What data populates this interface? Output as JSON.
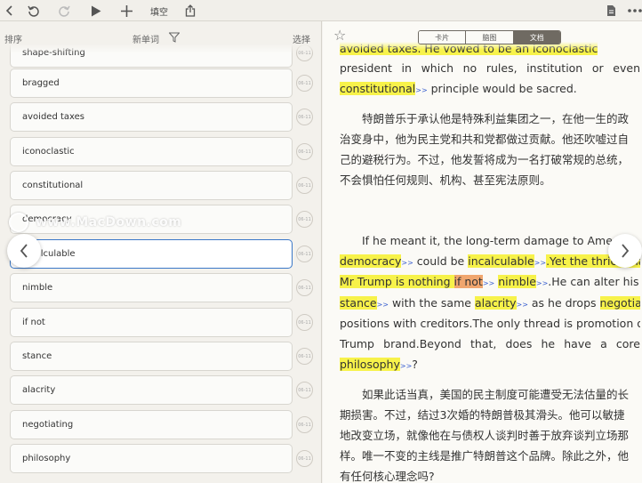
{
  "toolbar": {
    "fill_label": "填空"
  },
  "left_header": {
    "sort_label": "排序",
    "new_words_label": "新单词",
    "select_label": "选择"
  },
  "words": [
    {
      "text": "shape-shifting",
      "date": "06-11"
    },
    {
      "text": "bragged",
      "date": "06-11"
    },
    {
      "text": "avoided taxes",
      "date": "06-11"
    },
    {
      "text": "iconoclastic",
      "date": "06-11"
    },
    {
      "text": "constitutional",
      "date": "06-11"
    },
    {
      "text": "democracy",
      "date": "06-11"
    },
    {
      "text": "incalculable",
      "date": "06-11"
    },
    {
      "text": "nimble",
      "date": "06-11"
    },
    {
      "text": "if not",
      "date": "06-11"
    },
    {
      "text": "stance",
      "date": "06-11"
    },
    {
      "text": "alacrity",
      "date": "06-11"
    },
    {
      "text": "negotiating",
      "date": "06-11"
    },
    {
      "text": "philosophy",
      "date": "06-11"
    }
  ],
  "watermark": "www.MacDown.com",
  "right_header": {
    "segments": [
      "卡片",
      "脑图",
      "文档"
    ],
    "active_segment": "文档"
  },
  "article": {
    "top_partial": "avoided taxes. He vowed to be an iconoclastic",
    "p1_lines": [
      "president in which no rules, institution or even",
      [
        "constitutional",
        " principle would be sacred."
      ]
    ],
    "p2_lines": [
      "特朗普乐于承认他是特殊利益集团之一，在他一生的政",
      "治变身中，他为民主党和共和党都做过贡献。他还吹嘘过自",
      "己的避税行为。不过，他发誓将成为一名打破常规的总统，",
      "不会惧怕任何规则、机构、甚至宪法原则。"
    ],
    "p3": {
      "l1": "If he meant it, the long-term damage to Ame",
      "l2": {
        "w1": "democracy",
        "mid": " could be ",
        "w2": "incalculable",
        "tail": ".Yet the thrice-ma"
      },
      "l3": {
        "w1a": "Mr Trump is nothing ",
        "w1b": "if not",
        "w2": "nimble",
        "tail": ".He can alter his"
      },
      "l4": {
        "w1": "stance",
        "mid": " with the same ",
        "w2": "alacrity",
        "mid2": " as he drops ",
        "w3": "negotiating"
      },
      "l5": "positions with creditors.The only thread is promotion of the",
      "l6": "Trump brand.Beyond that, does he have a core",
      "l7": {
        "w1": "philosophy",
        "tail": "?"
      }
    },
    "p4_lines": [
      "如果此话当真，美国的民主制度可能遭受无法估量的长",
      "期损害。不过，结过3次婚的特朗普极其滑头。他可以敏捷",
      "地改变立场，就像他在与债权人谈判时善于放弃谈判立场那",
      "样。唯一不变的主线是推广特朗普这个品牌。除此之外，他",
      "有任何核心理念吗?"
    ],
    "arrow": ">>"
  },
  "colors": {
    "highlight": "#f7f24a",
    "highlight_alt": "#f0a66e",
    "active_border": "#3a78c8",
    "segment_active": "#6f6a62"
  }
}
